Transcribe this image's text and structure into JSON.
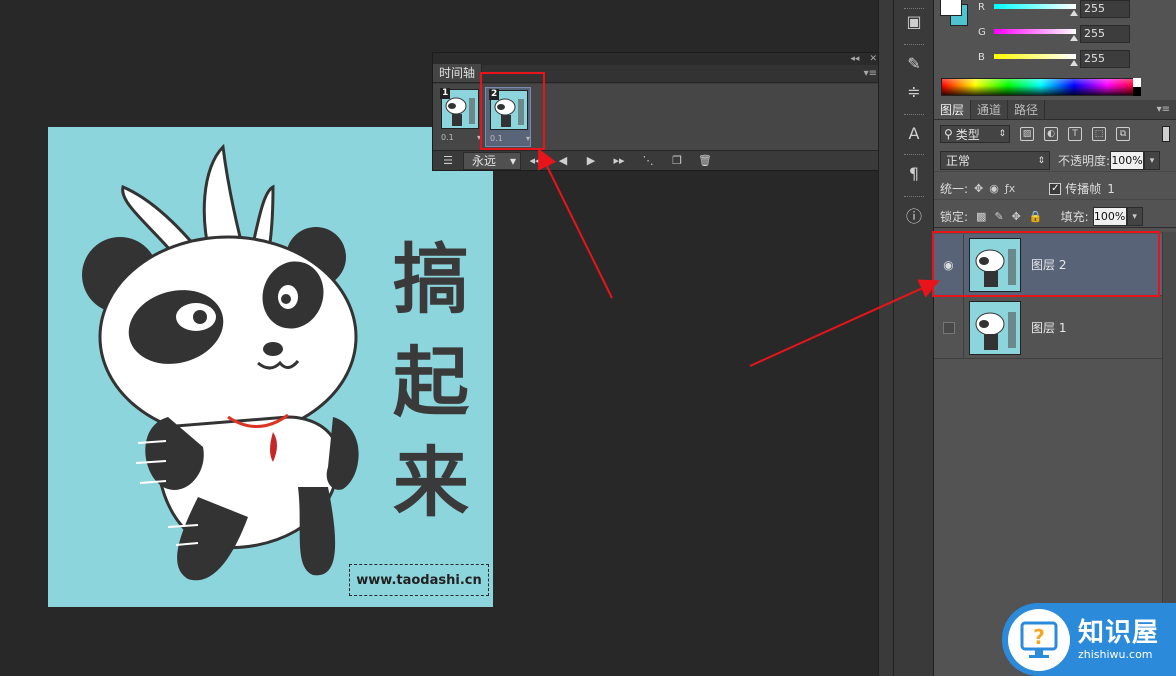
{
  "canvas": {
    "chars": [
      "搞",
      "起",
      "来"
    ],
    "website": "www.taodashi.cn"
  },
  "timeline": {
    "tab_label": "时间轴",
    "frames": [
      {
        "number": "1",
        "caption": "0.1",
        "delay_marker": "▾"
      },
      {
        "number": "2",
        "caption": "0.1",
        "delay_marker": "▾"
      }
    ],
    "loop_value": "永远",
    "collapse_glyph": "◂◂",
    "close_glyph": "✕"
  },
  "color": {
    "channels": [
      {
        "label": "R",
        "value": "255",
        "gradient": "#00ffff"
      },
      {
        "label": "G",
        "value": "255",
        "gradient": "#ff00ff"
      },
      {
        "label": "B",
        "value": "255",
        "gradient": "#ffff00"
      }
    ],
    "foreground": "#ffffff",
    "background": "#4fc4cf"
  },
  "layers": {
    "tabs": [
      "图层",
      "通道",
      "路径"
    ],
    "filter_label": "类型",
    "blend_mode": "正常",
    "opacity_label": "不透明度:",
    "opacity_value": "100%",
    "unify_label": "统一:",
    "propagate_label": "传播帧",
    "propagate_num": "1",
    "lock_label": "锁定:",
    "fill_label": "填充:",
    "fill_value": "100%",
    "items": [
      {
        "name": "图层 2",
        "visible": true,
        "selected": true
      },
      {
        "name": "图层 1",
        "visible": false,
        "selected": false
      }
    ]
  },
  "watermark": {
    "cn": "知识屋",
    "en": "zhishiwu.com"
  },
  "accent": "#e8141a",
  "selection_color": "#596378"
}
